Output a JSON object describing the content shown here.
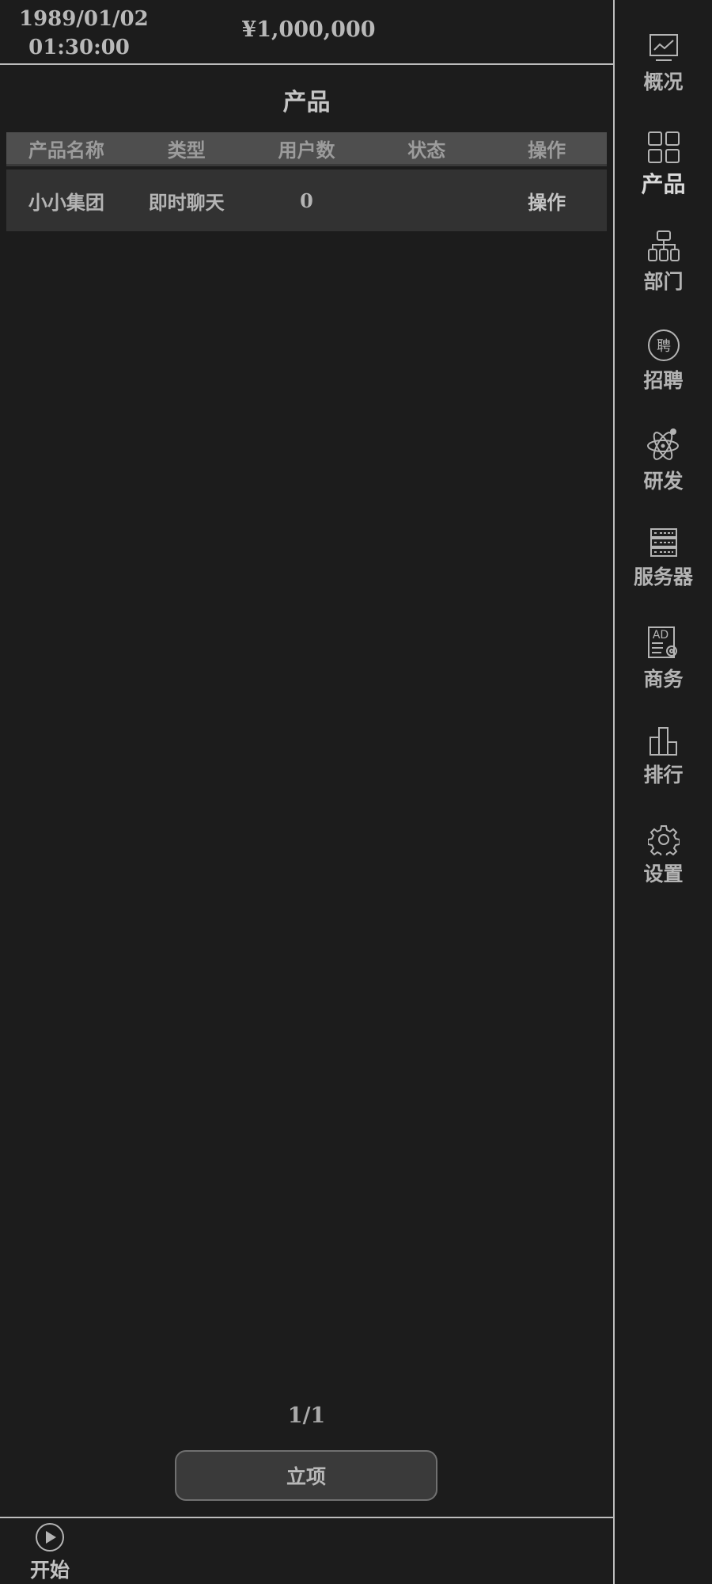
{
  "header": {
    "date": "1989/01/02",
    "time": "01:30:00",
    "money": "¥1,000,000"
  },
  "page": {
    "title": "产品"
  },
  "table": {
    "columns": [
      "产品名称",
      "类型",
      "用户数",
      "状态",
      "操作"
    ],
    "rows": [
      {
        "name": "小小集团",
        "type": "即时聊天",
        "users": "0",
        "status": "",
        "action": "操作"
      }
    ]
  },
  "pager": {
    "text": "1/1"
  },
  "actions": {
    "create_label": "立项"
  },
  "bottom": {
    "start_label": "开始",
    "start_icon": "play-circle-icon"
  },
  "sidebar": {
    "active": "产品",
    "items": [
      {
        "label": "概况",
        "icon": "chart-monitor-icon"
      },
      {
        "label": "产品",
        "icon": "grid-icon"
      },
      {
        "label": "部门",
        "icon": "org-chart-icon"
      },
      {
        "label": "招聘",
        "icon": "hire-circle-icon"
      },
      {
        "label": "研发",
        "icon": "atom-icon"
      },
      {
        "label": "服务器",
        "icon": "server-icon"
      },
      {
        "label": "商务",
        "icon": "ad-icon"
      },
      {
        "label": "排行",
        "icon": "ranking-bars-icon"
      },
      {
        "label": "设置",
        "icon": "gear-icon"
      }
    ],
    "hire_icon_text": "聘",
    "ad_icon_text": "AD"
  },
  "colors": {
    "background": "#1c1c1c",
    "panel": "#323232",
    "header_row": "#4e4e4e",
    "text": "#b9b9b9"
  }
}
